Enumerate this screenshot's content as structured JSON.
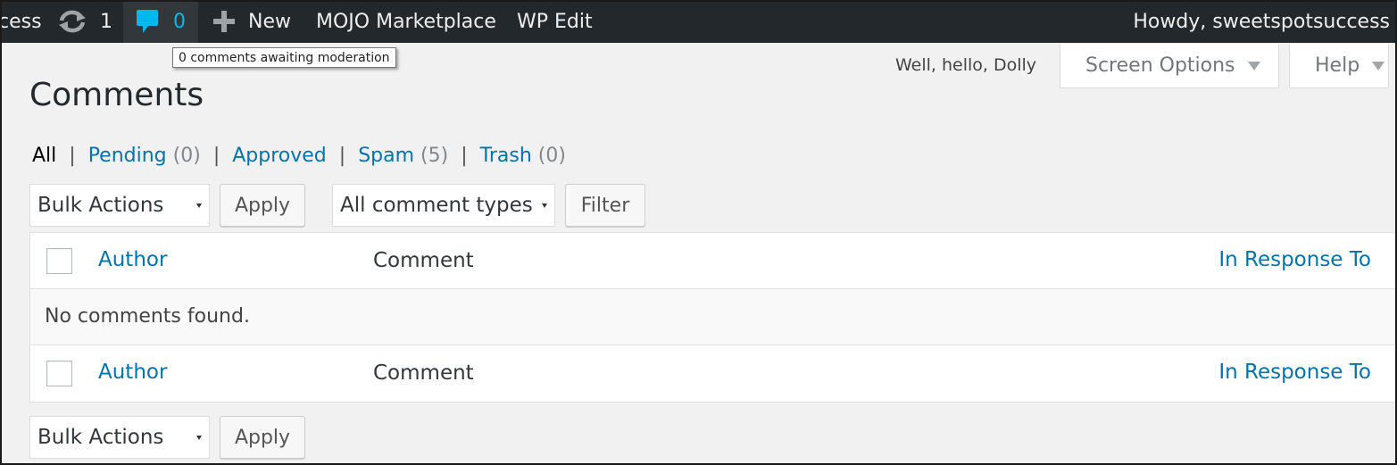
{
  "adminbar": {
    "site_name_fragment": "cess",
    "updates_count": "1",
    "comments_count": "0",
    "new_label": "New",
    "mojo_label": "MOJO Marketplace",
    "wpedit_label": "WP Edit",
    "howdy": "Howdy, sweetspotsuccess"
  },
  "tooltip": "0 comments awaiting moderation",
  "dolly": "Well, hello, Dolly",
  "tabs": {
    "screen_options": "Screen Options",
    "help": "Help"
  },
  "page_title": "Comments",
  "filters": {
    "all": "All",
    "pending": "Pending",
    "pending_count": "(0)",
    "approved": "Approved",
    "spam": "Spam",
    "spam_count": "(5)",
    "trash": "Trash",
    "trash_count": "(0)"
  },
  "toolbar_top": {
    "bulk_actions": "Bulk Actions",
    "apply": "Apply",
    "comment_types": "All comment types",
    "filter": "Filter"
  },
  "table": {
    "col_author": "Author",
    "col_comment": "Comment",
    "col_response": "In Response To",
    "empty": "No comments found."
  },
  "toolbar_bottom": {
    "bulk_actions": "Bulk Actions",
    "apply": "Apply"
  },
  "colors": {
    "adminbar_bg": "#23282d",
    "link": "#0073aa",
    "bubble": "#00b9eb"
  }
}
